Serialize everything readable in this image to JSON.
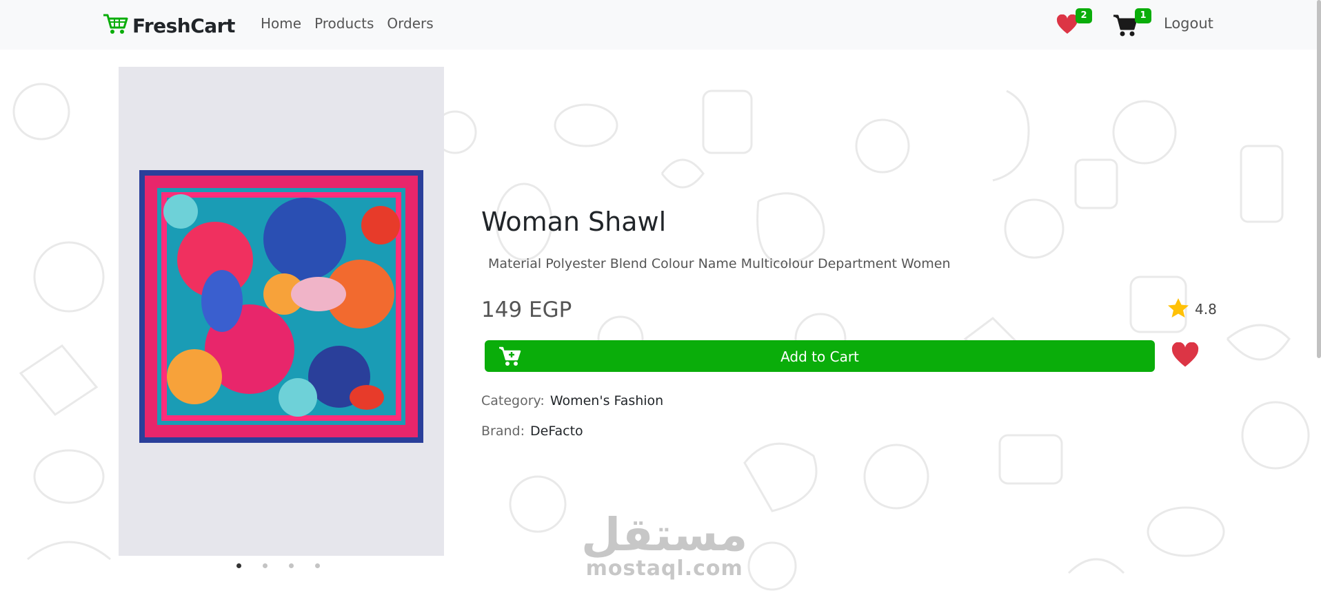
{
  "brand": {
    "name": "FreshCart",
    "icon": "cart-logo-icon",
    "color": "#0aad0a"
  },
  "nav": {
    "links": [
      "Home",
      "Products",
      "Orders"
    ]
  },
  "header": {
    "wishlist_count": "2",
    "cart_count": "1",
    "logout_label": "Logout"
  },
  "product": {
    "title": "Woman Shawl",
    "description": "Material Polyester Blend Colour Name Multicolour Department Women",
    "price": "149 EGP",
    "rating": "4.8",
    "add_to_cart_label": "Add to Cart",
    "category_label": "Category:",
    "category_value": "Women's Fashion",
    "brand_label": "Brand:",
    "brand_value": "DeFacto",
    "image_count": 4,
    "active_image": 1
  },
  "watermark": {
    "arabic": "مستقل",
    "latin": "mostaql.com"
  },
  "colors": {
    "accent": "#0aad0a",
    "heart": "#dc3545",
    "star": "#ffc107",
    "navbar_bg": "#f8f9fa"
  }
}
